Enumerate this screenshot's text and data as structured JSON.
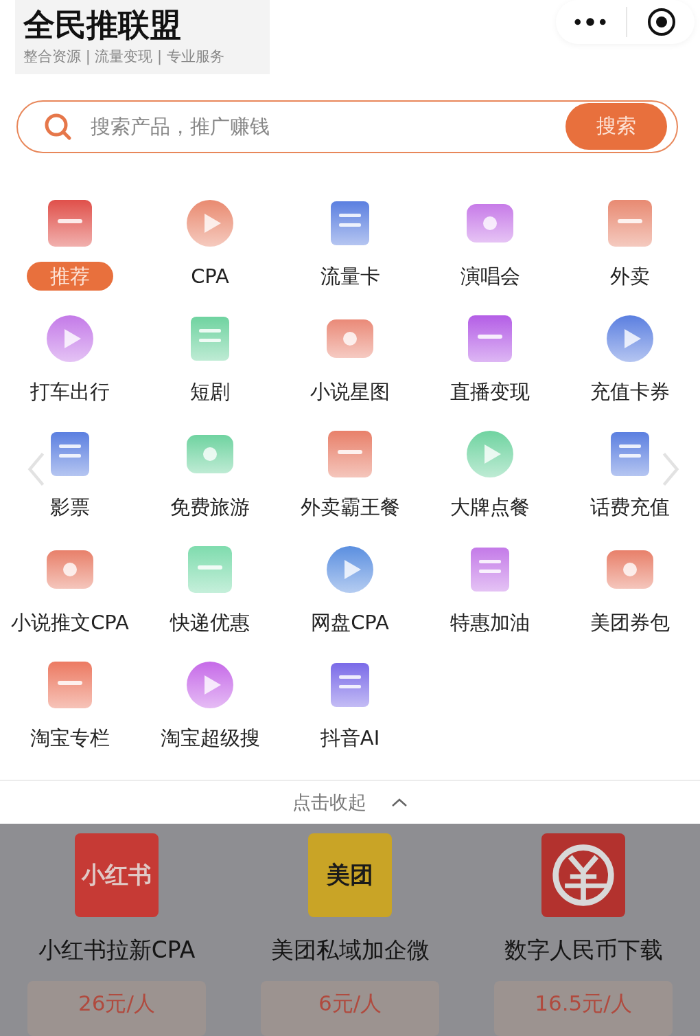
{
  "header": {
    "title": "全民推联盟",
    "subtitle": "整合资源 | 流量变现 | 专业服务"
  },
  "search": {
    "placeholder": "搜索产品，推广赚钱",
    "button": "搜索"
  },
  "categories": [
    {
      "label": "推荐",
      "selected": true
    },
    {
      "label": "CPA",
      "selected": false
    },
    {
      "label": "流量卡",
      "selected": false
    },
    {
      "label": "演唱会",
      "selected": false
    },
    {
      "label": "外卖",
      "selected": false
    },
    {
      "label": "打车出行",
      "selected": false
    },
    {
      "label": "短剧",
      "selected": false
    },
    {
      "label": "小说星图",
      "selected": false
    },
    {
      "label": "直播变现",
      "selected": false
    },
    {
      "label": "充值卡券",
      "selected": false
    },
    {
      "label": "影票",
      "selected": false
    },
    {
      "label": "免费旅游",
      "selected": false
    },
    {
      "label": "外卖霸王餐",
      "selected": false
    },
    {
      "label": "大牌点餐",
      "selected": false
    },
    {
      "label": "话费充值",
      "selected": false
    },
    {
      "label": "小说推文CPA",
      "selected": false
    },
    {
      "label": "快递优惠",
      "selected": false
    },
    {
      "label": "网盘CPA",
      "selected": false
    },
    {
      "label": "特惠加油",
      "selected": false
    },
    {
      "label": "美团券包",
      "selected": false
    },
    {
      "label": "淘宝专栏",
      "selected": false
    },
    {
      "label": "淘宝超级搜",
      "selected": false
    },
    {
      "label": "抖音AI",
      "selected": false
    }
  ],
  "collapse": {
    "label": "点击收起"
  },
  "products": [
    {
      "kind": "text_logo",
      "logo_text": "小红书",
      "color": "#c63a35",
      "title": "小红书拉新CPA",
      "price": "26元/人"
    },
    {
      "kind": "text_logo",
      "logo_text": "美团",
      "color": "#c9a426",
      "title": "美团私域加企微",
      "price": "6元/人"
    },
    {
      "kind": "yuan_logo",
      "color": "#b3322e",
      "title": "数字人民币下载",
      "price": "16.5元/人"
    }
  ]
}
